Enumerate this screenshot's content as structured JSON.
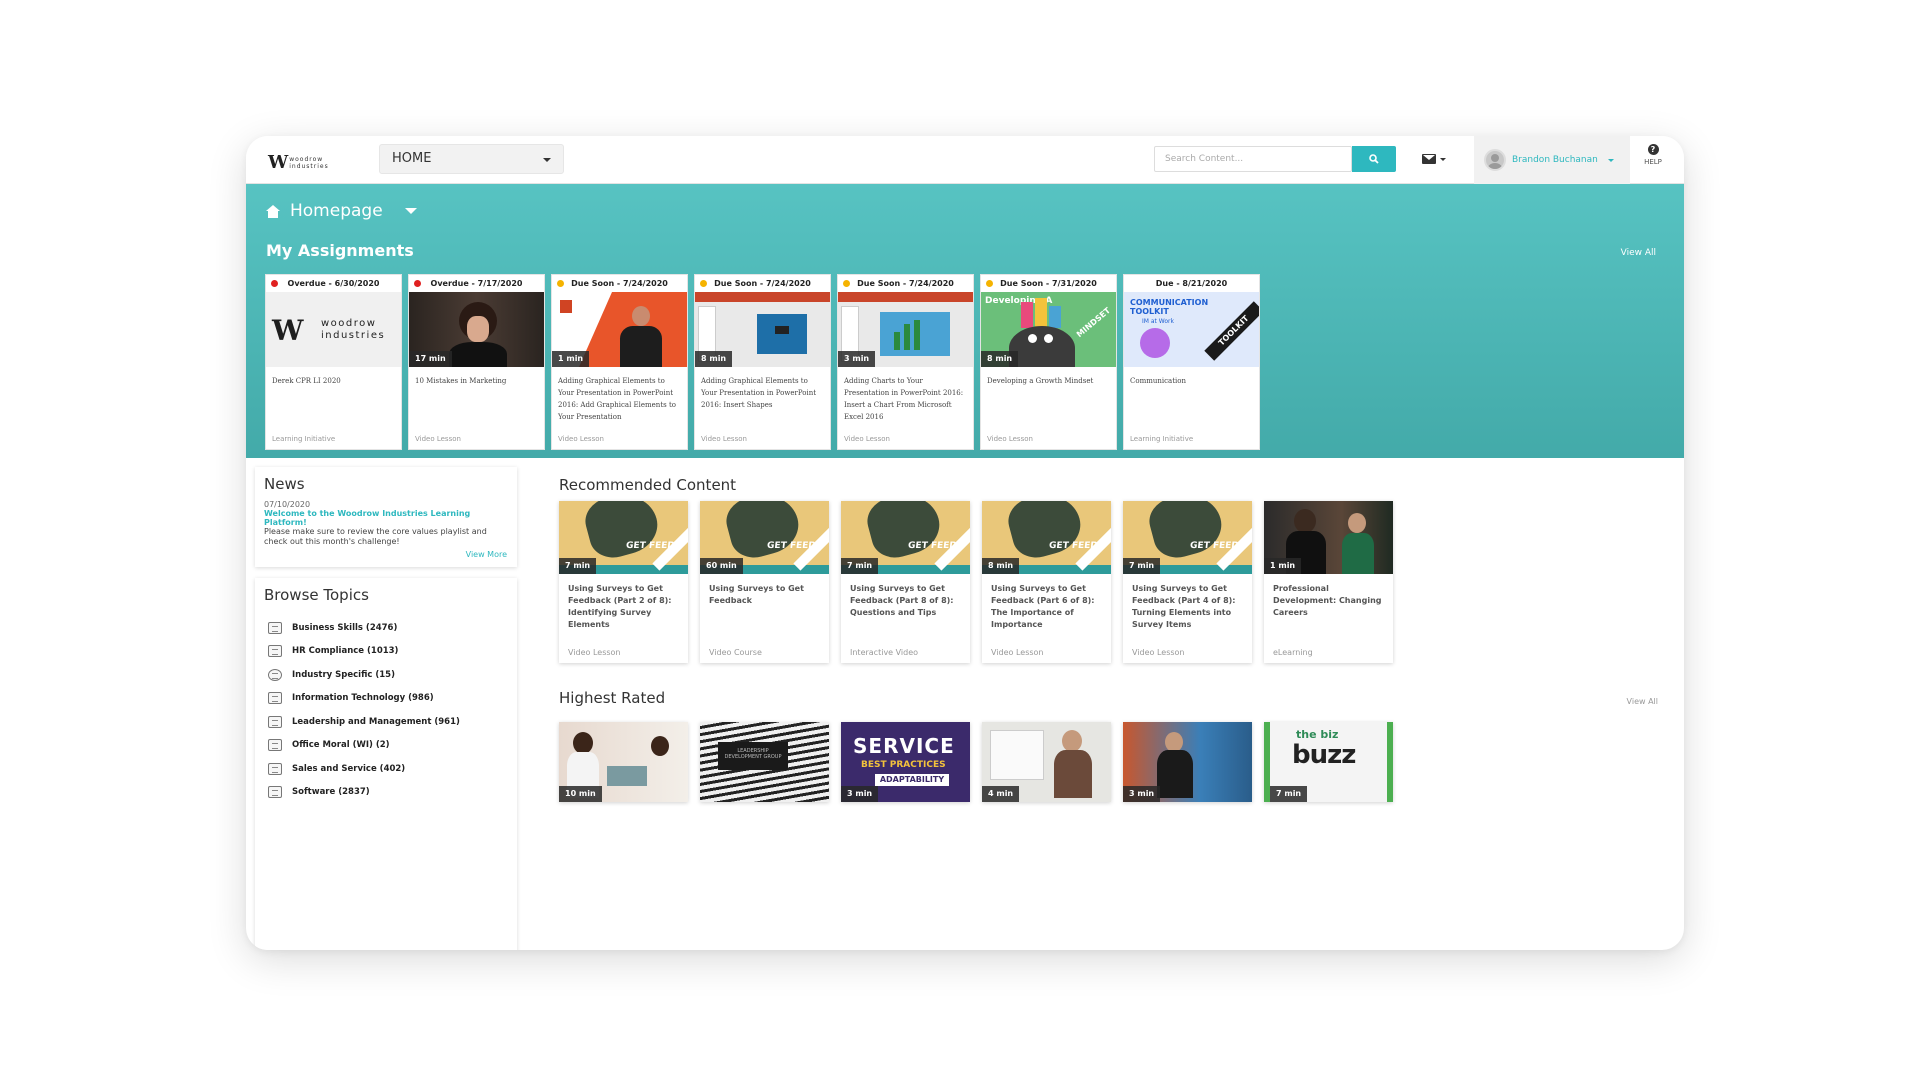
{
  "header": {
    "logo_mark": "W",
    "logo_line1": "woodrow",
    "logo_line2": "industries",
    "nav_select": "HOME",
    "search_placeholder": "Search Content...",
    "user_name": "Brandon Buchanan",
    "help_label": "HELP"
  },
  "banner": {
    "page_title": "Homepage",
    "assignments_title": "My Assignments",
    "view_all": "View All",
    "assignments": [
      {
        "due": "Overdue - 6/30/2020",
        "status": "overdue",
        "duration": "",
        "title": "Derek CPR LI 2020",
        "type": "Learning Initiative"
      },
      {
        "due": "Overdue - 7/17/2020",
        "status": "overdue",
        "duration": "17 min",
        "title": "10 Mistakes in Marketing",
        "type": "Video Lesson"
      },
      {
        "due": "Due Soon - 7/24/2020",
        "status": "soon",
        "duration": "1 min",
        "title": "Adding Graphical Elements to Your Presentation in PowerPoint 2016: Add Graphical Elements to Your Presentation",
        "type": "Video Lesson"
      },
      {
        "due": "Due Soon - 7/24/2020",
        "status": "soon",
        "duration": "8 min",
        "title": "Adding Graphical Elements to Your Presentation in PowerPoint 2016: Insert Shapes",
        "type": "Video Lesson"
      },
      {
        "due": "Due Soon - 7/24/2020",
        "status": "soon",
        "duration": "3 min",
        "title": "Adding Charts to Your Presentation in PowerPoint 2016: Insert a Chart From Microsoft Excel 2016",
        "type": "Video Lesson"
      },
      {
        "due": "Due Soon - 7/31/2020",
        "status": "soon",
        "duration": "8 min",
        "title": "Developing a Growth Mindset",
        "type": "Video Lesson"
      },
      {
        "due": "Due - 8/21/2020",
        "status": "due",
        "duration": "",
        "title": "Communication",
        "type": "Learning Initiative"
      }
    ]
  },
  "thumb_text": {
    "developing": "Developing A",
    "mindset": "MINDSET",
    "toolkit1": "COMMUNICATION TOOLKIT",
    "toolkit2": "IM at Work",
    "toolkit3": "TOOLKIT",
    "get_feedback": "GET FEEDB",
    "service1": "SERVICE",
    "service2": "BEST PRACTICES",
    "service3": "ADAPTABILITY",
    "biz1": "the biz",
    "biz2": "buzz",
    "ldg": "LEADERSHIP DEVELOPMENT GROUP"
  },
  "news": {
    "title": "News",
    "date": "07/10/2020",
    "headline": "Welcome to the Woodrow Industries Learning Platform!",
    "body": "Please make sure to review the core values playlist and check out this month's challenge!",
    "more": "View More"
  },
  "browse": {
    "title": "Browse Topics",
    "topics": [
      "Business Skills (2476)",
      "HR Compliance (1013)",
      "Industry Specific (15)",
      "Information Technology (986)",
      "Leadership and Management (961)",
      "Office Moral (WI) (2)",
      "Sales and Service (402)",
      "Software (2837)"
    ]
  },
  "recommended": {
    "title": "Recommended Content",
    "items": [
      {
        "duration": "7 min",
        "title": "Using Surveys to Get Feedback (Part 2 of 8): Identifying Survey Elements",
        "type": "Video Lesson"
      },
      {
        "duration": "60 min",
        "title": "Using Surveys to Get Feedback",
        "type": "Video Course"
      },
      {
        "duration": "7 min",
        "title": "Using Surveys to Get Feedback (Part 8 of 8): Questions and Tips",
        "type": "Interactive Video"
      },
      {
        "duration": "8 min",
        "title": "Using Surveys to Get Feedback (Part 6 of 8): The Importance of Importance",
        "type": "Video Lesson"
      },
      {
        "duration": "7 min",
        "title": "Using Surveys to Get Feedback (Part 4 of 8): Turning Elements into Survey Items",
        "type": "Video Lesson"
      },
      {
        "duration": "1 min",
        "title": "Professional Development: Changing Careers",
        "type": "eLearning"
      }
    ]
  },
  "highest": {
    "title": "Highest Rated",
    "view_all": "View All",
    "durations": [
      "10 min",
      "",
      "3 min",
      "4 min",
      "3 min",
      "7 min"
    ]
  },
  "colors": {
    "accent": "#2eb8bf",
    "banner": "#4fb9b8",
    "overdue": "#e02020",
    "soon": "#f5b300"
  }
}
